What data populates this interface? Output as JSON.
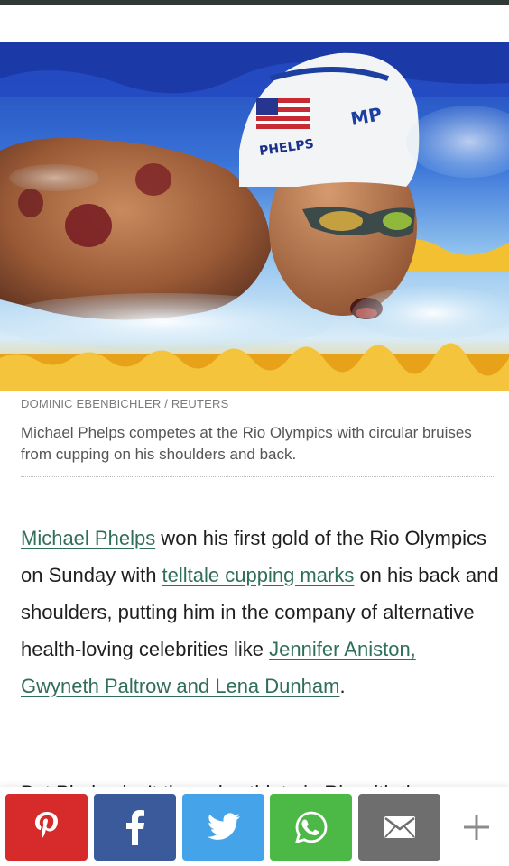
{
  "photo": {
    "credit": "DOMINIC EBENBICHLER / REUTERS",
    "caption": "Michael Phelps competes at the Rio Olympics with circular bruises from cupping on his shoulders and back.",
    "cap_text": "PHELPS",
    "cap_logo": "MP"
  },
  "article": {
    "p1_link1": "Michael Phelps",
    "p1_text1": " won his first gold of the Rio Olympics on Sunday with ",
    "p1_link2": "telltale cupping marks",
    "p1_text2": " on his back and shoulders, putting him in the company of alternative health-loving celebrities like ",
    "p1_link3": "Jennifer Aniston, Gwyneth Paltrow and Lena Dunham",
    "p1_text3": ".",
    "p2_partial": "But Phelps isn’t the only athlete in Rio with the"
  },
  "share": {
    "pinterest": "pinterest-icon",
    "facebook": "facebook-icon",
    "twitter": "twitter-icon",
    "whatsapp": "whatsapp-icon",
    "email": "email-icon",
    "more": "plus-icon",
    "colors": {
      "pinterest": "#d72a2a",
      "facebook": "#3a5a9b",
      "twitter": "#45a3ea",
      "whatsapp": "#4cb845",
      "email": "#6e6e6e",
      "link": "#2f6f57"
    }
  }
}
